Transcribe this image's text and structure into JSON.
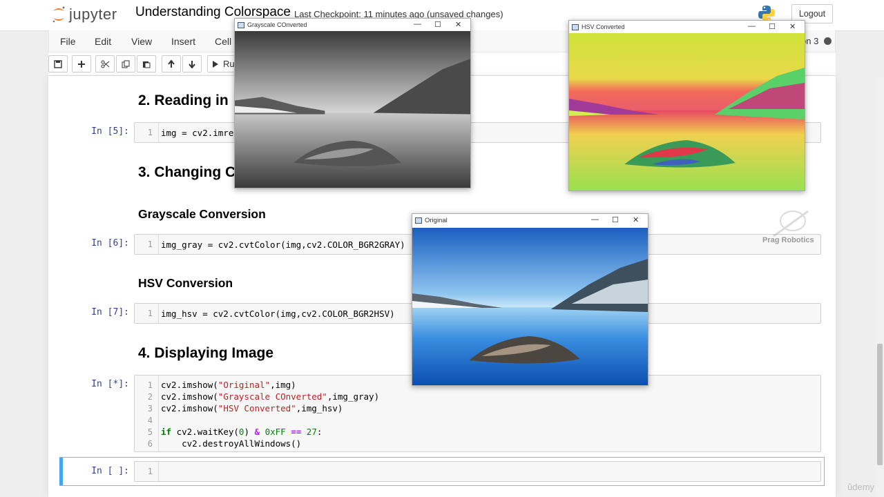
{
  "header": {
    "logo_text": "jupyter",
    "notebook_title": "Understanding Colorspace",
    "checkpoint": "Last Checkpoint: 11 minutes ago  (unsaved changes)",
    "logout_label": "Logout"
  },
  "menubar": {
    "items": [
      "File",
      "Edit",
      "View",
      "Insert",
      "Cell"
    ],
    "kernel_suffix": "on 3"
  },
  "toolbar": {
    "run_label": "Ru"
  },
  "cells": {
    "h_reading": "2. Reading in",
    "prompt_5": "In [5]:",
    "code_5": "img = cv2.imre",
    "h_changing": "3. Changing C",
    "h_grayscale": "Grayscale Conversion",
    "prompt_6": "In [6]:",
    "code_6": "img_gray = cv2.cvtColor(img,cv2.COLOR_BGR2GRAY)",
    "h_hsv": "HSV Conversion",
    "prompt_7": "In [7]:",
    "code_7": "img_hsv = cv2.cvtColor(img,cv2.COLOR_BGR2HSV)",
    "h_display": "4. Displaying Image",
    "prompt_8": "In [*]:",
    "code_8_line1_a": "cv2.imshow(",
    "code_8_line1_s": "\"Original\"",
    "code_8_line1_b": ",img)",
    "code_8_line2_a": "cv2.imshow(",
    "code_8_line2_s": "\"Grayscale COnverted\"",
    "code_8_line2_b": ",img_gray)",
    "code_8_line3_a": "cv2.imshow(",
    "code_8_line3_s": "\"HSV Converted\"",
    "code_8_line3_b": ",img_hsv)",
    "code_8_line5_kw": "if",
    "code_8_line5_a": " cv2.waitKey(",
    "code_8_line5_n0": "0",
    "code_8_line5_b": ") ",
    "code_8_line5_op1": "&",
    "code_8_line5_c": " ",
    "code_8_line5_n1": "0xFF",
    "code_8_line5_d": " ",
    "code_8_line5_op2": "==",
    "code_8_line5_e": " ",
    "code_8_line5_n2": "27",
    "code_8_line5_f": ":",
    "code_8_line6": "    cv2.destroyAllWindows()",
    "prompt_9": "In [ ]:",
    "line_numbers": [
      "1",
      "2",
      "3",
      "4",
      "5",
      "6"
    ]
  },
  "windows": {
    "grayscale_title": "Grayscale COnverted",
    "hsv_title": "HSV Converted",
    "original_title": "Original",
    "min_glyph": "—",
    "max_glyph": "☐",
    "close_glyph": "✕"
  },
  "watermark": {
    "brand": "Prag Robotics",
    "udemy": "ûdemy"
  },
  "colors": {
    "prompt_in": "#303f9f",
    "active_cell": "#42a5f5",
    "keyword": "#008000",
    "string": "#ba2121"
  }
}
